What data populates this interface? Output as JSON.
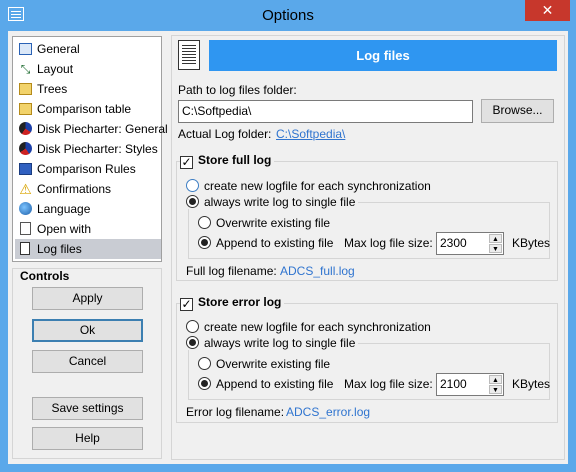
{
  "window": {
    "title": "Options",
    "close_glyph": "✕"
  },
  "tree": {
    "items": [
      {
        "label": "General",
        "icon": "general-icon"
      },
      {
        "label": "Layout",
        "icon": "layout-icon"
      },
      {
        "label": "Trees",
        "icon": "trees-icon"
      },
      {
        "label": "Comparison table",
        "icon": "comparison-table-icon"
      },
      {
        "label": "Disk Piecharter: General",
        "icon": "piechart-icon"
      },
      {
        "label": "Disk Piecharter: Styles",
        "icon": "piechart-styles-icon"
      },
      {
        "label": "Comparison Rules",
        "icon": "rules-icon"
      },
      {
        "label": "Confirmations",
        "icon": "warning-icon"
      },
      {
        "label": "Language",
        "icon": "globe-icon"
      },
      {
        "label": "Open with",
        "icon": "open-with-icon"
      },
      {
        "label": "Log files",
        "icon": "log-files-icon",
        "selected": true
      }
    ]
  },
  "controls": {
    "label": "Controls",
    "apply": "Apply",
    "ok": "Ok",
    "cancel": "Cancel",
    "save_settings": "Save settings",
    "help": "Help"
  },
  "panel": {
    "header": "Log files",
    "path_label": "Path to log files folder:",
    "path_value": "C:\\Softpedia\\",
    "browse": "Browse...",
    "actual_label": "Actual Log folder:",
    "actual_value": "C:\\Softpedia\\",
    "full_log": {
      "title": "Store full log",
      "checked": true,
      "opt_each": "create new logfile for each synchronization",
      "opt_single": "always write log to single file",
      "opt_overwrite": "Overwrite existing file",
      "opt_append": "Append to existing file",
      "max_label": "Max log file size:",
      "max_value": "2300",
      "unit": "KBytes",
      "filename_label": "Full log filename:",
      "filename_value": "ADCS_full.log"
    },
    "error_log": {
      "title": "Store error log",
      "checked": true,
      "opt_each": "create new logfile for each synchronization",
      "opt_single": "always write log to single file",
      "opt_overwrite": "Overwrite existing file",
      "opt_append": "Append to existing file",
      "max_label": "Max log file size:",
      "max_value": "2100",
      "unit": "KBytes",
      "filename_label": "Error log filename:",
      "filename_value": "ADCS_error.log"
    }
  },
  "colors": {
    "titlebar": "#5aa8ea",
    "accent": "#2f96f1",
    "link": "#2f74cf",
    "close": "#c7372c"
  }
}
